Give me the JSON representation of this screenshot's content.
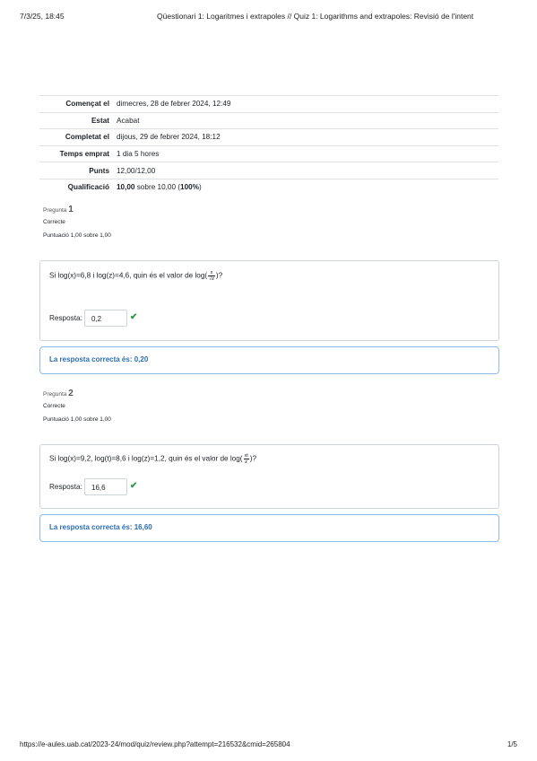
{
  "print_header": {
    "date": "7/3/25, 18:45",
    "title": "Qüestionari 1: Logaritmes i extrapoles // Quiz 1: Logarithms and extrapoles: Revisió de l'intent"
  },
  "summary": [
    {
      "label": "Començat el",
      "value": "dimecres, 28 de febrer 2024, 12:49"
    },
    {
      "label": "Estat",
      "value": "Acabat"
    },
    {
      "label": "Completat el",
      "value": "dijous, 29 de febrer 2024, 18:12"
    },
    {
      "label": "Temps emprat",
      "value": "1 dia 5 hores"
    },
    {
      "label": "Punts",
      "value": "12,00/12,00"
    },
    {
      "label": "Qualificació",
      "value_bold": "10,00",
      "value_mid": " sobre 10,00 (",
      "value_pct": "100%",
      "value_end": ")"
    }
  ],
  "questions": [
    {
      "prefix": "Pregunta",
      "number": "1",
      "state": "Correcte",
      "grade": "Puntuació 1,00 sobre 1,00",
      "text_before": "Si log(x)=6,8 i log(z)=4,6, quin és el valor de log(",
      "frac_num": "x",
      "frac_den": "√z",
      "text_after": ")?",
      "answer_label": "Resposta:",
      "answer_value": "0,2",
      "right_answer": "La resposta correcta és: 0,20"
    },
    {
      "prefix": "Pregunta",
      "number": "2",
      "state": "Correcte",
      "grade": "Puntuació 1,00 sobre 1,00",
      "text_before": "Si log(x)=9,2, log(t)=8,6 i log(z)=1,2, quin és el valor de log(",
      "frac_num": "xt",
      "frac_den": "z",
      "text_after": ")?",
      "answer_label": "Resposta:",
      "answer_value": "16,6",
      "right_answer": "La resposta correcta és: 16,60"
    }
  ],
  "print_footer": {
    "url": "https://e-aules.uab.cat/2023-24/mod/quiz/review.php?attempt=216532&cmid=265804",
    "page": "1/5"
  },
  "icons": {
    "check": "check-icon"
  },
  "colors": {
    "check": "#2c9b44",
    "feedback_border": "#8bbbe8",
    "feedback_text": "#2a6db3"
  }
}
